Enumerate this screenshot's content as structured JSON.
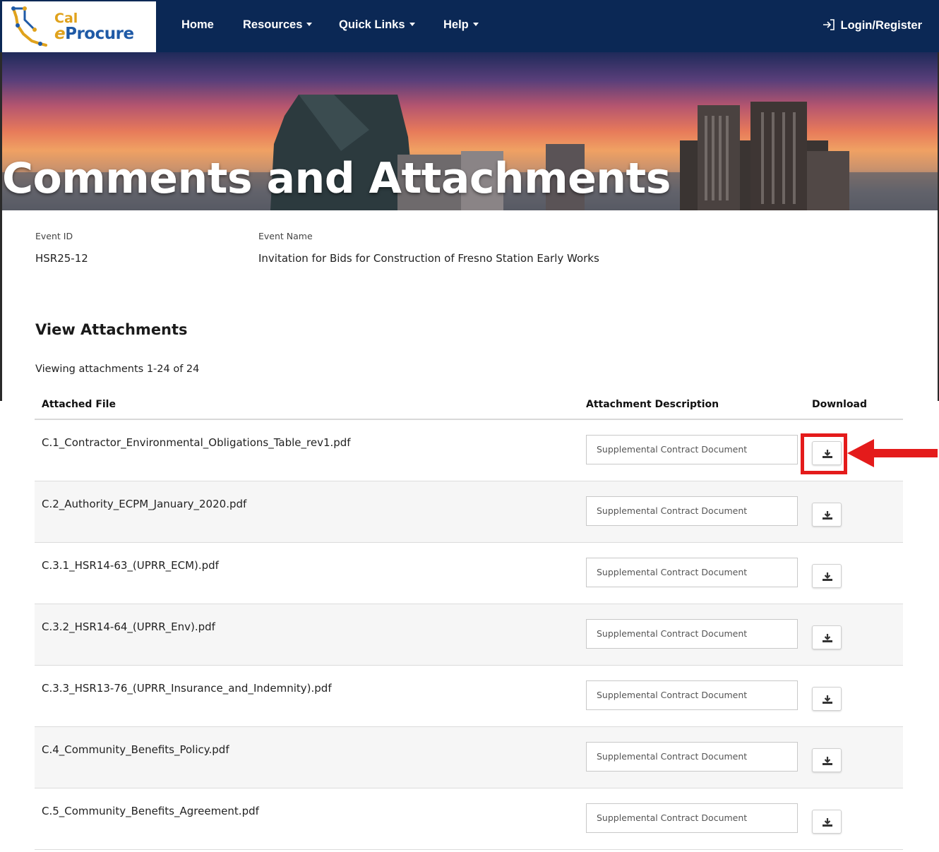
{
  "nav": {
    "logo_top": "Cal",
    "logo_e": "e",
    "logo_bottom": "Procure",
    "items": [
      {
        "label": "Home"
      },
      {
        "label": "Resources"
      },
      {
        "label": "Quick Links"
      },
      {
        "label": "Help"
      }
    ],
    "login_label": "Login/Register"
  },
  "hero": {
    "title": "Comments and Attachments"
  },
  "event": {
    "id_label": "Event ID",
    "id_value": "HSR25-12",
    "name_label": "Event Name",
    "name_value": "Invitation for Bids for Construction of Fresno Station Early Works"
  },
  "attachments": {
    "title": "View Attachments",
    "count_text": "Viewing attachments 1-24 of 24",
    "columns": {
      "file": "Attached File",
      "description": "Attachment Description",
      "download": "Download"
    },
    "rows": [
      {
        "file": "C.1_Contractor_Environmental_Obligations_Table_rev1.pdf",
        "description": "Supplemental Contract Document"
      },
      {
        "file": "C.2_Authority_ECPM_January_2020.pdf",
        "description": "Supplemental Contract Document"
      },
      {
        "file": "C.3.1_HSR14-63_(UPRR_ECM).pdf",
        "description": "Supplemental Contract Document"
      },
      {
        "file": "C.3.2_HSR14-64_(UPRR_Env).pdf",
        "description": "Supplemental Contract Document"
      },
      {
        "file": "C.3.3_HSR13-76_(UPRR_Insurance_and_Indemnity).pdf",
        "description": "Supplemental Contract Document"
      },
      {
        "file": "C.4_Community_Benefits_Policy.pdf",
        "description": "Supplemental Contract Document"
      },
      {
        "file": "C.5_Community_Benefits_Agreement.pdf",
        "description": "Supplemental Contract Document"
      }
    ]
  },
  "annotation": {
    "color": "#e41b1b"
  },
  "colors": {
    "nav_bg": "#0b2855",
    "logo_gold": "#e0a21c",
    "logo_blue": "#1f5aa6"
  }
}
